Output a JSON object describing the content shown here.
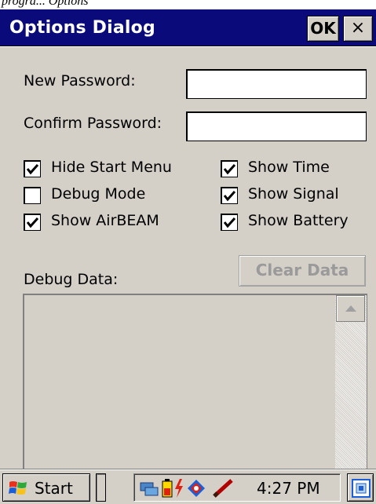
{
  "page_caption": "progra... Options",
  "window": {
    "title": "Options Dialog",
    "ok_label": "OK",
    "close_label": "×"
  },
  "form": {
    "new_password_label": "New Password:",
    "new_password_value": "",
    "confirm_password_label": "Confirm Password:",
    "confirm_password_value": ""
  },
  "checkboxes": [
    {
      "label": "Hide Start Menu",
      "checked": true
    },
    {
      "label": "Debug Mode",
      "checked": false
    },
    {
      "label": "Show AirBEAM",
      "checked": true
    },
    {
      "label": "Show Time",
      "checked": true
    },
    {
      "label": "Show Signal",
      "checked": true
    },
    {
      "label": "Show Battery",
      "checked": true
    }
  ],
  "debug": {
    "label": "Debug Data:",
    "clear_button_label": "Clear Data",
    "clear_button_enabled": false,
    "content": ""
  },
  "taskbar": {
    "start_label": "Start",
    "clock": "4:27 PM",
    "tray_icons": [
      "network-icon",
      "battery-icon",
      "power-icon",
      "airbeam-icon",
      "pen-icon"
    ],
    "sip_icon": "keyboard-sip-icon"
  },
  "colors": {
    "title_bar": "#0a0a7a",
    "dialog_bg": "#d4d0c8",
    "disabled_text": "#9a9a9a"
  }
}
